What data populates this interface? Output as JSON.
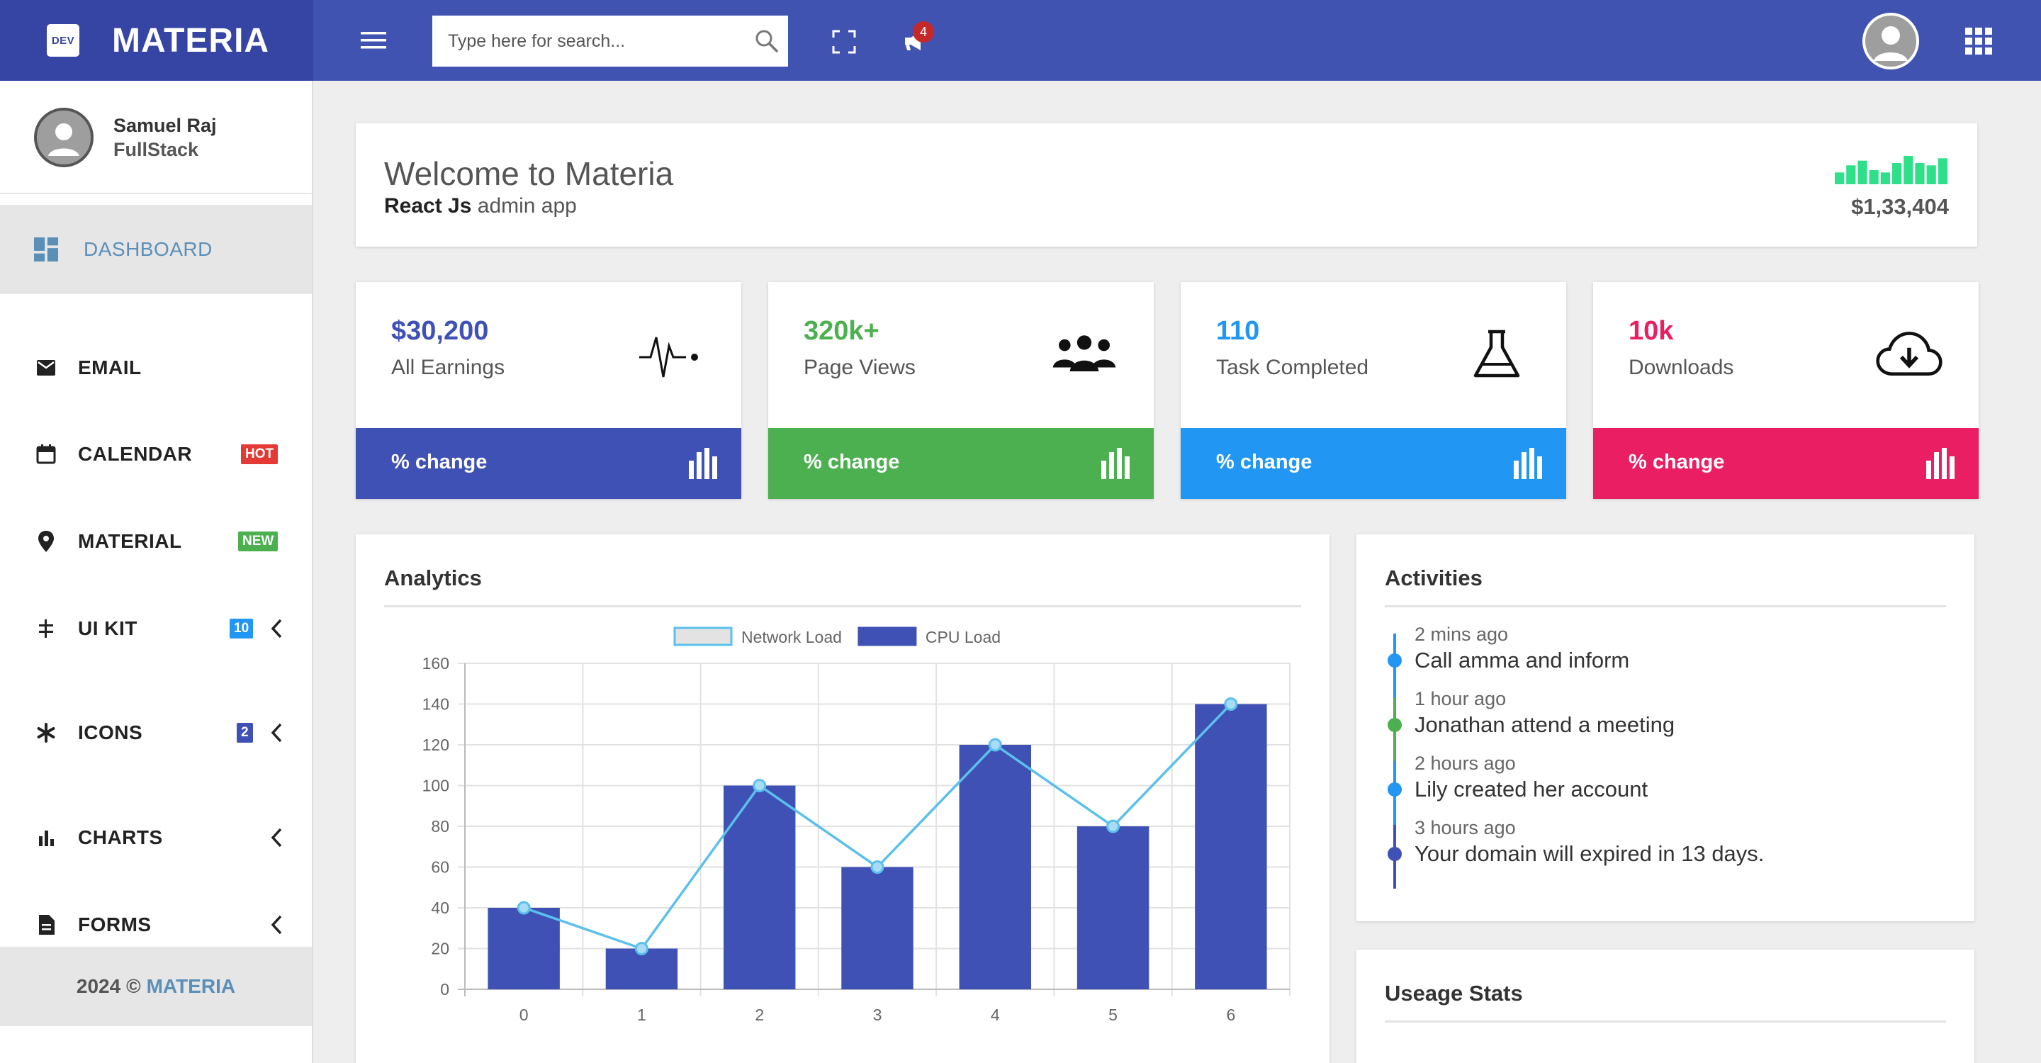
{
  "app": {
    "logo_text": "DEV",
    "brand_name": "MATERIA"
  },
  "topbar": {
    "search_placeholder": "Type here for search...",
    "notification_count": "4",
    "icons": [
      "menu-icon",
      "search-icon",
      "fullscreen-icon",
      "megaphone-icon",
      "user-avatar",
      "apps-grid-icon"
    ]
  },
  "sidebar": {
    "profile": {
      "name": "Samuel Raj",
      "role": "FullStack"
    },
    "items": [
      {
        "label": "DASHBOARD",
        "icon": "dashboard-icon",
        "active": true
      },
      {
        "label": "EMAIL",
        "icon": "email-icon"
      },
      {
        "label": "CALENDAR",
        "icon": "calendar-icon",
        "badge": "HOT",
        "badge_color": "#e53935"
      },
      {
        "label": "MATERIAL",
        "icon": "pin-icon",
        "badge": "NEW",
        "badge_color": "#4caf50"
      },
      {
        "label": "UI KIT",
        "icon": "ui-kit-icon",
        "badge": "10",
        "badge_color": "#2196f3",
        "chevron": true
      },
      {
        "label": "ICONS",
        "icon": "asterisk-icon",
        "badge": "2",
        "badge_color": "#3f51b5",
        "chevron": true
      },
      {
        "label": "CHARTS",
        "icon": "bar-chart-icon",
        "chevron": true
      },
      {
        "label": "FORMS",
        "icon": "document-icon",
        "chevron": true
      }
    ],
    "footer": {
      "year": "2024 ©",
      "brand": "MATERIA"
    }
  },
  "welcome": {
    "title": "Welcome to Materia",
    "subtitle_bold": "React Js",
    "subtitle_rest": "admin app",
    "amount": "$1,33,404",
    "spark_values": [
      5,
      8,
      10,
      6,
      5,
      9,
      12,
      9,
      8,
      11
    ],
    "spark_color": "#2ee08a"
  },
  "stats": [
    {
      "value": "$30,200",
      "label": "All Earnings",
      "footer": "% change",
      "color": "#3f51b5",
      "icon": "heartbeat-icon"
    },
    {
      "value": "320k+",
      "label": "Page Views",
      "footer": "% change",
      "color": "#4caf50",
      "icon": "people-icon"
    },
    {
      "value": "110",
      "label": "Task Completed",
      "footer": "% change",
      "color": "#2196f3",
      "icon": "flask-icon"
    },
    {
      "value": "10k",
      "label": "Downloads",
      "footer": "% change",
      "color": "#e91e63",
      "icon": "cloud-download-icon"
    }
  ],
  "analytics": {
    "title": "Analytics"
  },
  "chart_data": {
    "type": "bar",
    "categories": [
      "0",
      "1",
      "2",
      "3",
      "4",
      "5",
      "6"
    ],
    "series": [
      {
        "name": "CPU Load",
        "type": "bar",
        "values": [
          40,
          20,
          100,
          60,
          120,
          80,
          140
        ],
        "color": "#3f51b5"
      },
      {
        "name": "Network Load",
        "type": "line",
        "values": [
          40,
          20,
          100,
          60,
          120,
          80,
          140
        ],
        "color": "#5bc0eb"
      }
    ],
    "ylim": [
      0,
      160
    ],
    "yticks": [
      "0",
      "20",
      "40",
      "60",
      "80",
      "100",
      "120",
      "140",
      "160"
    ],
    "legend": "top",
    "grid": true
  },
  "activities": {
    "title": "Activities",
    "items": [
      {
        "time": "2 mins ago",
        "text": "Call amma and inform",
        "color": "#2196f3"
      },
      {
        "time": "1 hour ago",
        "text": "Jonathan attend a meeting",
        "color": "#4caf50"
      },
      {
        "time": "2 hours ago",
        "text": "Lily created her account",
        "color": "#2196f3"
      },
      {
        "time": "3 hours ago",
        "text": "Your domain will expired in 13 days.",
        "color": "#3f51b5"
      }
    ]
  },
  "usage": {
    "title": "Useage Stats"
  }
}
